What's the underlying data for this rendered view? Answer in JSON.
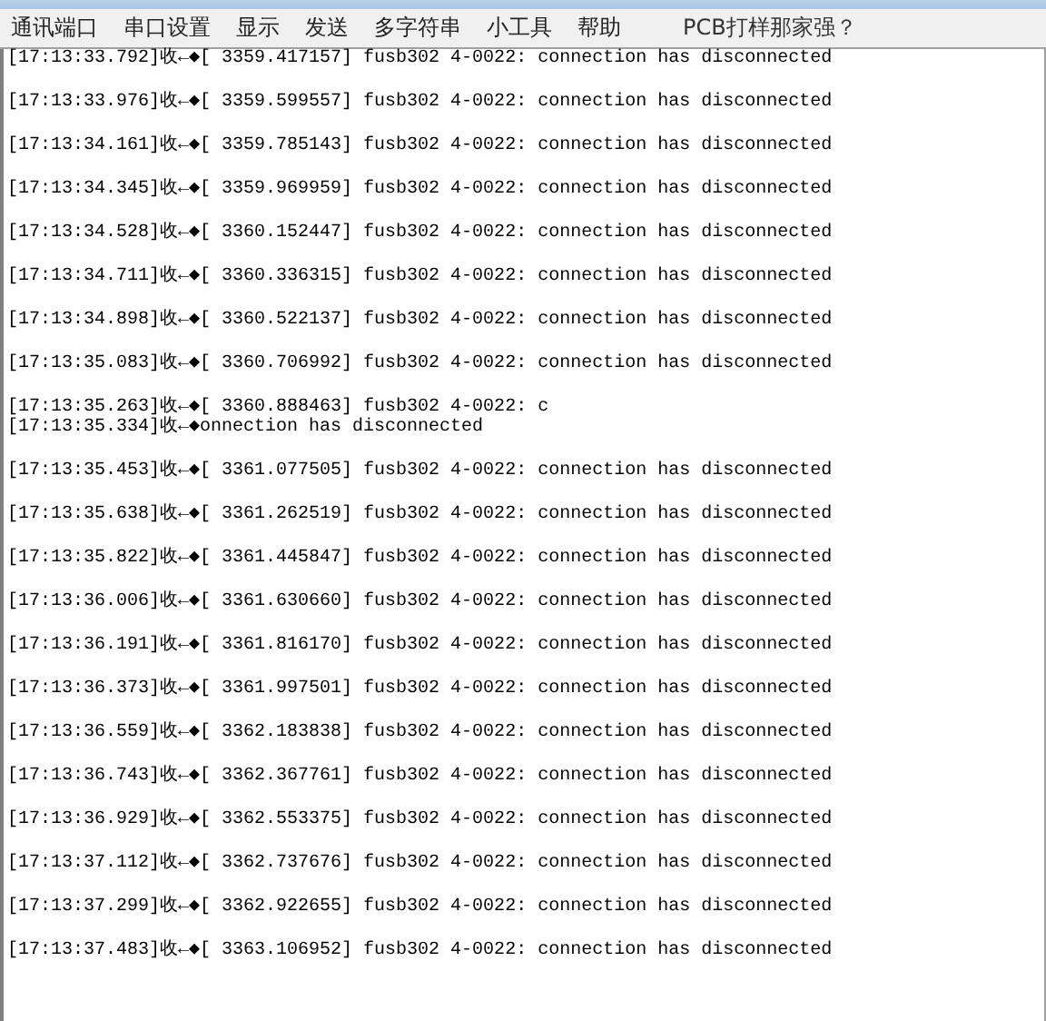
{
  "menu": [
    "通讯端口",
    "串口设置",
    "显示",
    "发送",
    "多字符串",
    "小工具",
    "帮助",
    "PCB打样那家强？"
  ],
  "log": [
    {
      "kind": "spaced",
      "text": "[17:13:33.792]收←◆[ 3359.417157] fusb302 4-0022: connection has disconnected"
    },
    {
      "kind": "spaced",
      "text": "[17:13:33.976]收←◆[ 3359.599557] fusb302 4-0022: connection has disconnected"
    },
    {
      "kind": "spaced",
      "text": "[17:13:34.161]收←◆[ 3359.785143] fusb302 4-0022: connection has disconnected"
    },
    {
      "kind": "spaced",
      "text": "[17:13:34.345]收←◆[ 3359.969959] fusb302 4-0022: connection has disconnected"
    },
    {
      "kind": "spaced",
      "text": "[17:13:34.528]收←◆[ 3360.152447] fusb302 4-0022: connection has disconnected"
    },
    {
      "kind": "spaced",
      "text": "[17:13:34.711]收←◆[ 3360.336315] fusb302 4-0022: connection has disconnected"
    },
    {
      "kind": "spaced",
      "text": "[17:13:34.898]收←◆[ 3360.522137] fusb302 4-0022: connection has disconnected"
    },
    {
      "kind": "spaced",
      "text": "[17:13:35.083]收←◆[ 3360.706992] fusb302 4-0022: connection has disconnected"
    },
    {
      "kind": "spaced",
      "text": "[17:13:35.263]收←◆[ 3360.888463] fusb302 4-0022: c"
    },
    {
      "kind": "joined",
      "text": "[17:13:35.334]收←◆onnection has disconnected"
    },
    {
      "kind": "spaced",
      "text": "[17:13:35.453]收←◆[ 3361.077505] fusb302 4-0022: connection has disconnected"
    },
    {
      "kind": "spaced",
      "text": "[17:13:35.638]收←◆[ 3361.262519] fusb302 4-0022: connection has disconnected"
    },
    {
      "kind": "spaced",
      "text": "[17:13:35.822]收←◆[ 3361.445847] fusb302 4-0022: connection has disconnected"
    },
    {
      "kind": "spaced",
      "text": "[17:13:36.006]收←◆[ 3361.630660] fusb302 4-0022: connection has disconnected"
    },
    {
      "kind": "spaced",
      "text": "[17:13:36.191]收←◆[ 3361.816170] fusb302 4-0022: connection has disconnected"
    },
    {
      "kind": "spaced",
      "text": "[17:13:36.373]收←◆[ 3361.997501] fusb302 4-0022: connection has disconnected"
    },
    {
      "kind": "spaced",
      "text": "[17:13:36.559]收←◆[ 3362.183838] fusb302 4-0022: connection has disconnected"
    },
    {
      "kind": "spaced",
      "text": "[17:13:36.743]收←◆[ 3362.367761] fusb302 4-0022: connection has disconnected"
    },
    {
      "kind": "spaced",
      "text": "[17:13:36.929]收←◆[ 3362.553375] fusb302 4-0022: connection has disconnected"
    },
    {
      "kind": "spaced",
      "text": "[17:13:37.112]收←◆[ 3362.737676] fusb302 4-0022: connection has disconnected"
    },
    {
      "kind": "spaced",
      "text": "[17:13:37.299]收←◆[ 3362.922655] fusb302 4-0022: connection has disconnected"
    },
    {
      "kind": "spaced",
      "text": "[17:13:37.483]收←◆[ 3363.106952] fusb302 4-0022: connection has disconnected"
    }
  ]
}
